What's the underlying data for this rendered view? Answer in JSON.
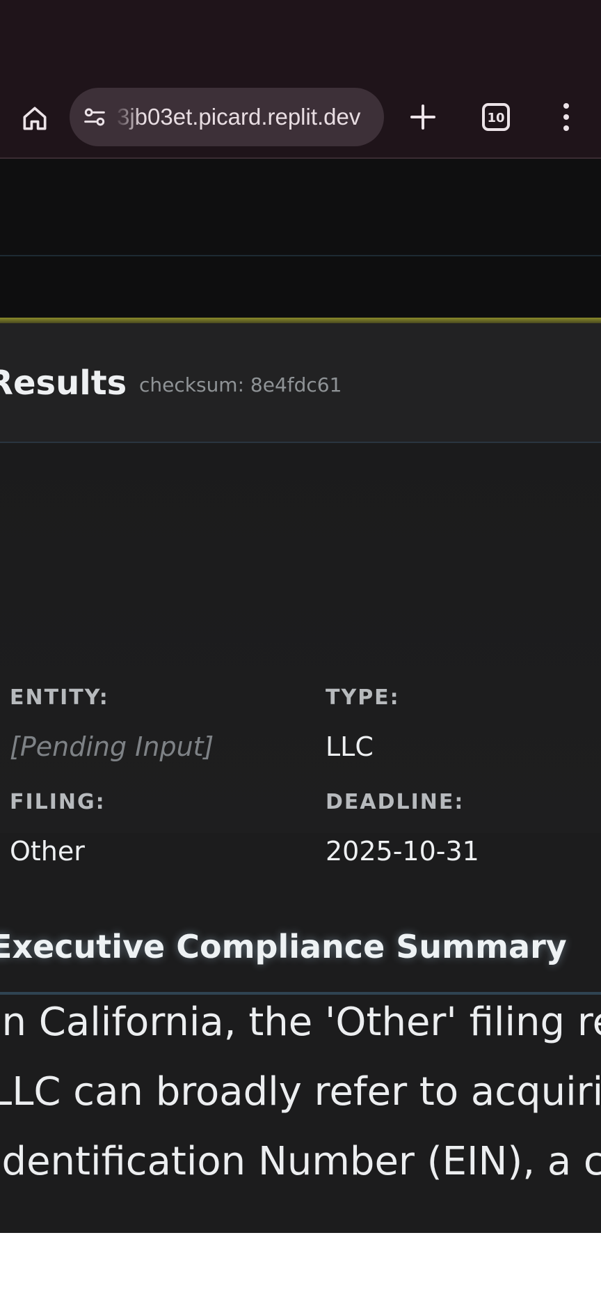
{
  "browser": {
    "url_text": "3jb03et.picard.replit.dev",
    "tab_count": "10",
    "colors": {
      "toolbar_bg": "#1f141a",
      "pill_bg": "#3d3038"
    }
  },
  "results": {
    "title": "Results",
    "checksum": "checksum: 8e4fdc61"
  },
  "meta": {
    "entity_label": "ENTITY:",
    "entity_value": "[Pending Input]",
    "type_label": "TYPE:",
    "type_value": "LLC",
    "filing_label": "FILING:",
    "filing_value": "Other",
    "deadline_label": "DEADLINE:",
    "deadline_value": "2025-10-31"
  },
  "summary": {
    "title": "Executive Compliance Summary",
    "lines": [
      "In California, the 'Other' filing re",
      "LLC can broadly refer to acquirin",
      "Identification Number (EIN), a cr"
    ]
  },
  "colors": {
    "accent": "#8a8a2a",
    "page_bg": "#1c1c1d",
    "muted_text": "#8f9396"
  }
}
